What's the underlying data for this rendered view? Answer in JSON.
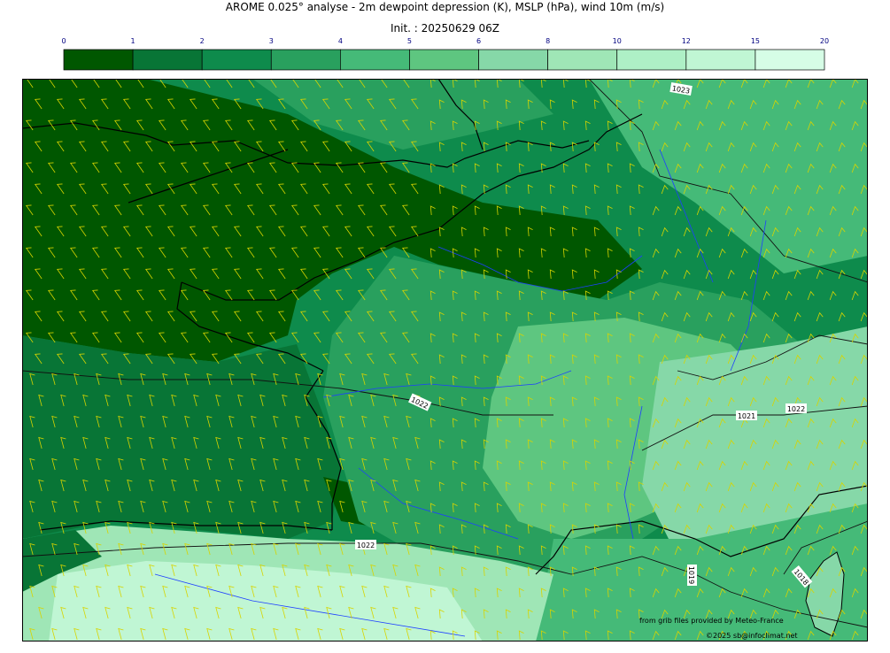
{
  "header": {
    "title": "AROME 0.025° analyse - 2m dewpoint depression (K), MSLP (hPa), wind 10m (m/s)",
    "init": "Init. : 20250629 06Z"
  },
  "colorbar": {
    "ticks": [
      "0",
      "1",
      "2",
      "3",
      "4",
      "5",
      "6",
      "8",
      "10",
      "12",
      "15",
      "20"
    ],
    "colors": [
      "#005700",
      "#087536",
      "#0e8b4c",
      "#29a05e",
      "#45ba78",
      "#5ec680",
      "#86d8a8",
      "#9fe6b6",
      "#aef0c6",
      "#c0f6d4",
      "#d6fde6"
    ]
  },
  "map": {
    "isobar_labels": [
      "1023",
      "1022",
      "1022",
      "1021",
      "1022",
      "1019",
      "1018"
    ],
    "colors": {
      "sea_dark": "#005700",
      "coast": "#000000",
      "rivers": "#1f3fff",
      "wind_barbs": "#d7d400"
    }
  },
  "footer": {
    "source": "from grib files provided by Meteo-France",
    "copyright": "©2025 sb@infoclimat.net"
  }
}
